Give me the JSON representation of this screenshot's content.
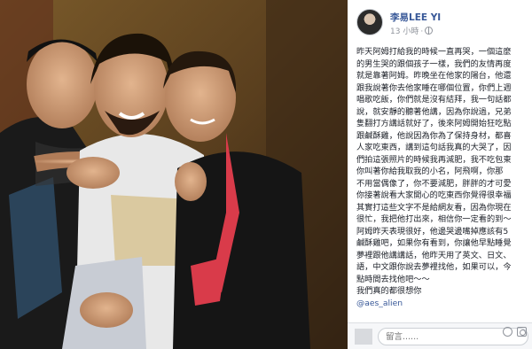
{
  "post": {
    "author": "李易LEE YI",
    "time": "13 小時",
    "lines": [
      "昨天阿姆打給我的時候一直再哭，一個這麼",
      "的男生哭的跟個孩子一樣，我們的友情再度",
      "就是靠著阿姆。昨晚坐在他家的陽台，他還",
      "跟我說著你去他家睡在哪個位置，你們上週",
      "唱歌吃飯，你們就是沒有結拜，我一句話都",
      "說，就安靜的聽著他講，因為你說過，兄弟",
      "隻翻打方講話就好了，後來阿姆開始狂吃點",
      "跟鹹酥雞，他說因為你為了保持身材，都喜",
      "人家吃東西，講到這句話我真的大哭了，因",
      "們拍這張照片的時候我再減肥，我不吃包東",
      "你叫著你給我取我的小名，阿飛啊，你那",
      "不用當偶像了，你不要減肥，胖胖的才可愛",
      "你接著說看大家開心的吃東西你覺得很幸福",
      "其實打這些文字不是給網友看，因為你現在",
      "很忙，我把他打出來，相信你一定看的到～",
      "阿姆昨天表現很好，他邊哭邊嘴掉應該有5",
      "鹹酥雞吧，如果你有看到，你讓他早點睡覺",
      "夢裡跟他講講話，他昨天用了英文、日文、",
      "語，中文跟你說去夢裡找他，如果可以，今",
      "點時間去找他吧～～",
      "我們真的都很想你"
    ],
    "tag": "@aes_alien"
  },
  "comment": {
    "placeholder": "留言......"
  }
}
